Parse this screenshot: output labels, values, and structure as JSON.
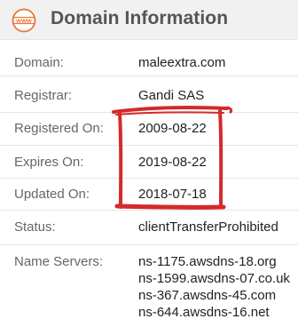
{
  "header": {
    "icon": "www-globe-icon",
    "title": "Domain Information",
    "accent_color": "#e8773a"
  },
  "rows": [
    {
      "label": "Domain:",
      "value": "maleextra.com"
    },
    {
      "label": "Registrar:",
      "value": "Gandi SAS"
    },
    {
      "label": "Registered On:",
      "value": "2009-08-22"
    },
    {
      "label": "Expires On:",
      "value": "2019-08-22"
    },
    {
      "label": "Updated On:",
      "value": "2018-07-18"
    },
    {
      "label": "Status:",
      "value": "clientTransferProhibited"
    }
  ],
  "name_servers": {
    "label": "Name Servers:",
    "values": [
      "ns-1175.awsdns-18.org",
      "ns-1599.awsdns-07.co.uk",
      "ns-367.awsdns-45.com",
      "ns-644.awsdns-16.net"
    ]
  },
  "annotation": {
    "color": "#d42a2a",
    "shape": "hand-drawn-box"
  }
}
